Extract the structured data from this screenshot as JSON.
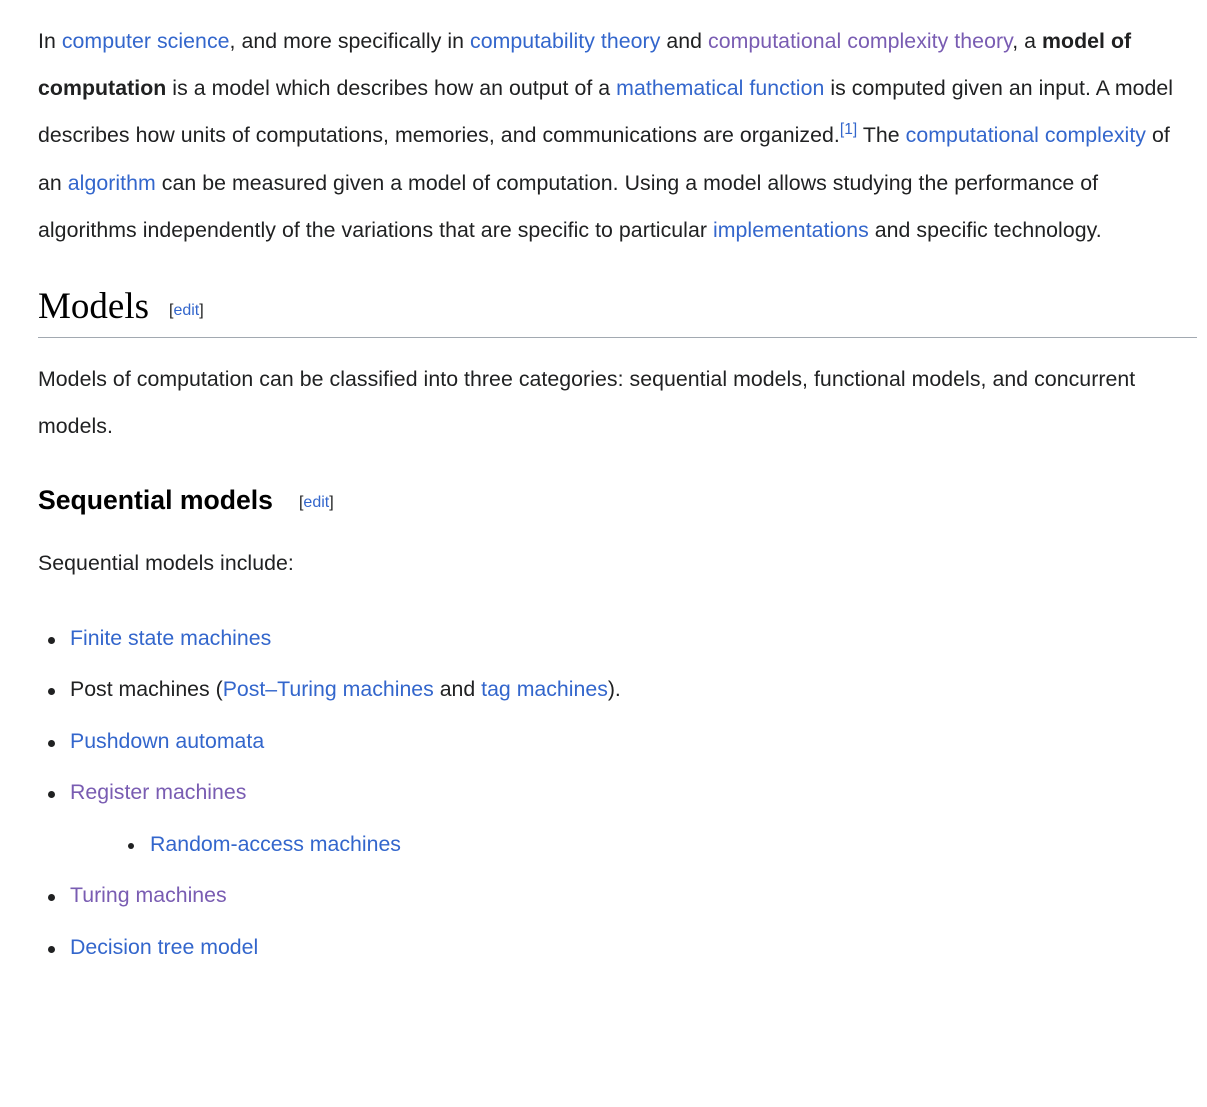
{
  "article": {
    "intro": {
      "seg_1": "In ",
      "link_computer_science": "computer science",
      "seg_2": ", and more specifically in ",
      "link_computability_theory": "computability theory",
      "seg_3": " and ",
      "link_computational_complexity_theory": "computational complexity theory",
      "seg_4": ", a ",
      "bold_term": "model of computation",
      "seg_5": " is a model which describes how an output of a ",
      "link_mathematical_function": "mathematical function",
      "seg_6": " is computed given an input. A model describes how units of computations, memories, and communications are organized.",
      "ref_1": "[1]",
      "seg_7": " The ",
      "link_computational_complexity": "computational complexity",
      "seg_8": " of an ",
      "link_algorithm": "algorithm",
      "seg_9": " can be measured given a model of computation. Using a model allows studying the performance of algorithms independently of the variations that are specific to particular ",
      "link_implementations": "implementations",
      "seg_10": " and specific technology."
    },
    "models_section": {
      "heading": "Models",
      "edit_open_bracket": "[",
      "edit_label": "edit",
      "edit_close_bracket": "]",
      "paragraph": "Models of computation can be classified into three categories: sequential models, functional models, and concurrent models."
    },
    "sequential_section": {
      "heading": "Sequential models",
      "edit_open_bracket": "[",
      "edit_label": "edit",
      "edit_close_bracket": "]",
      "intro_line": "Sequential models include:",
      "items": {
        "item_1_link": "Finite state machines",
        "item_2_prefix": "Post machines (",
        "item_2_link_a": "Post–Turing machines",
        "item_2_mid": " and ",
        "item_2_link_b": "tag machines",
        "item_2_suffix": ").",
        "item_3_link": "Pushdown automata",
        "item_4_link": "Register machines",
        "item_4_sub_link": "Random-access machines",
        "item_5_link": "Turing machines",
        "item_6_link": "Decision tree model"
      }
    }
  },
  "colors": {
    "link_blue": "#3366cc",
    "link_visited_purple": "#795cb2",
    "text": "#202122",
    "rule": "#a2a9b1",
    "background": "#ffffff"
  }
}
